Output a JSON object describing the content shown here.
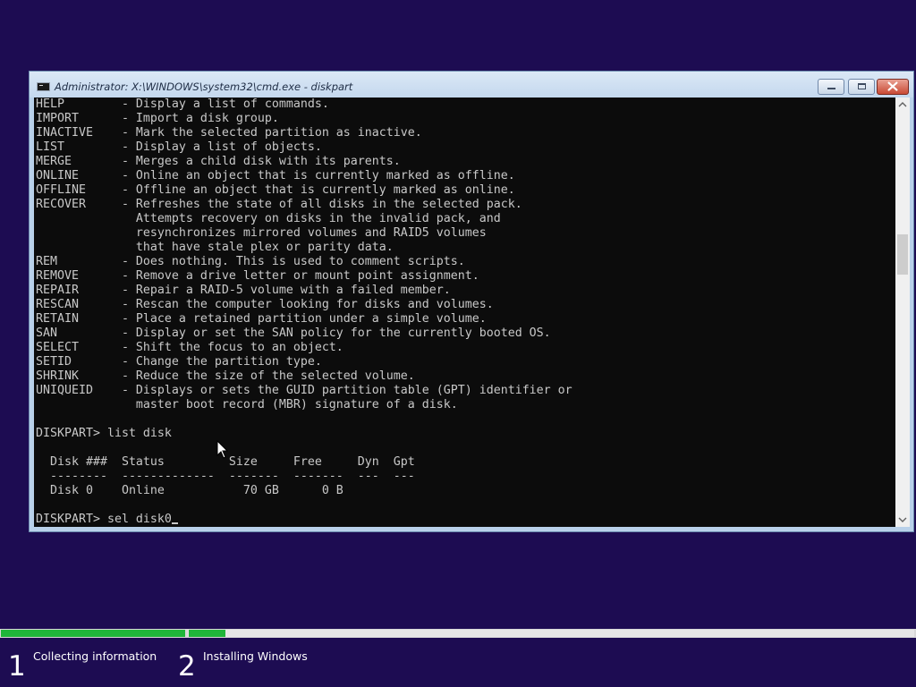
{
  "window": {
    "title": "Administrator: X:\\WINDOWS\\system32\\cmd.exe - diskpart",
    "buttons": {
      "minimize": "minimize",
      "maximize": "maximize",
      "close": "close"
    }
  },
  "console": {
    "lines": [
      "HELP        - Display a list of commands.",
      "IMPORT      - Import a disk group.",
      "INACTIVE    - Mark the selected partition as inactive.",
      "LIST        - Display a list of objects.",
      "MERGE       - Merges a child disk with its parents.",
      "ONLINE      - Online an object that is currently marked as offline.",
      "OFFLINE     - Offline an object that is currently marked as online.",
      "RECOVER     - Refreshes the state of all disks in the selected pack.",
      "              Attempts recovery on disks in the invalid pack, and",
      "              resynchronizes mirrored volumes and RAID5 volumes",
      "              that have stale plex or parity data.",
      "REM         - Does nothing. This is used to comment scripts.",
      "REMOVE      - Remove a drive letter or mount point assignment.",
      "REPAIR      - Repair a RAID-5 volume with a failed member.",
      "RESCAN      - Rescan the computer looking for disks and volumes.",
      "RETAIN      - Place a retained partition under a simple volume.",
      "SAN         - Display or set the SAN policy for the currently booted OS.",
      "SELECT      - Shift the focus to an object.",
      "SETID       - Change the partition type.",
      "SHRINK      - Reduce the size of the selected volume.",
      "UNIQUEID    - Displays or sets the GUID partition table (GPT) identifier or",
      "              master boot record (MBR) signature of a disk.",
      "",
      "DISKPART> list disk",
      "",
      "  Disk ###  Status         Size     Free     Dyn  Gpt",
      "  --------  -------------  -------  -------  ---  ---",
      "  Disk 0    Online           70 GB      0 B",
      "",
      "DISKPART> sel disk0"
    ]
  },
  "setup": {
    "progress": [
      1.0,
      0.05
    ],
    "steps": [
      {
        "number": "1",
        "label": "Collecting information"
      },
      {
        "number": "2",
        "label": "Installing Windows"
      }
    ]
  },
  "colors": {
    "background": "#1d0c52",
    "progress": "#1fb53a",
    "console_bg": "#0c0c0c",
    "console_text": "#c8c8c8"
  }
}
